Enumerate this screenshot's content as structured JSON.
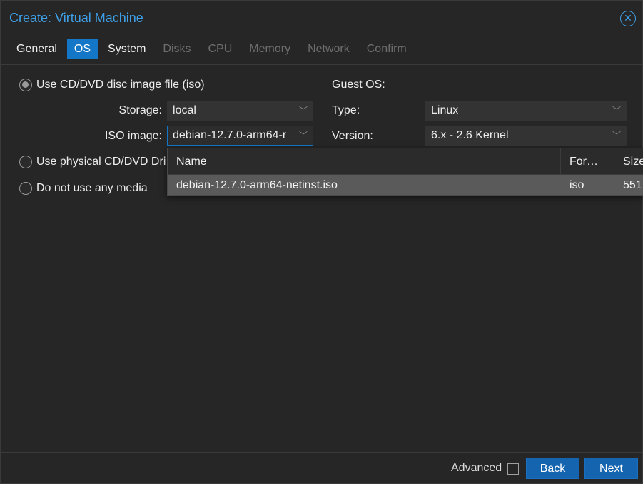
{
  "window": {
    "title": "Create: Virtual Machine"
  },
  "tabs": [
    {
      "label": "General",
      "state": "enabled"
    },
    {
      "label": "OS",
      "state": "active"
    },
    {
      "label": "System",
      "state": "enabled"
    },
    {
      "label": "Disks",
      "state": "disabled"
    },
    {
      "label": "CPU",
      "state": "disabled"
    },
    {
      "label": "Memory",
      "state": "disabled"
    },
    {
      "label": "Network",
      "state": "disabled"
    },
    {
      "label": "Confirm",
      "state": "disabled"
    }
  ],
  "media": {
    "option_iso": "Use CD/DVD disc image file (iso)",
    "option_physical": "Use physical CD/DVD Dri",
    "option_none": "Do not use any media",
    "storage_label": "Storage:",
    "storage_value": "local",
    "iso_label": "ISO image:",
    "iso_value": "debian-12.7.0-arm64-r"
  },
  "guest_os": {
    "heading": "Guest OS:",
    "type_label": "Type:",
    "type_value": "Linux",
    "version_label": "Version:",
    "version_value": "6.x - 2.6 Kernel"
  },
  "iso_dropdown": {
    "columns": [
      "Name",
      "For…",
      "Size"
    ],
    "rows": [
      {
        "name": "debian-12.7.0-arm64-netinst.iso",
        "format": "iso",
        "size": "551."
      }
    ]
  },
  "footer": {
    "advanced_label": "Advanced",
    "back_label": "Back",
    "next_label": "Next"
  },
  "colors": {
    "accent": "#3e9fe6",
    "button": "#1464b0",
    "selected_row": "#5a5a5a"
  }
}
